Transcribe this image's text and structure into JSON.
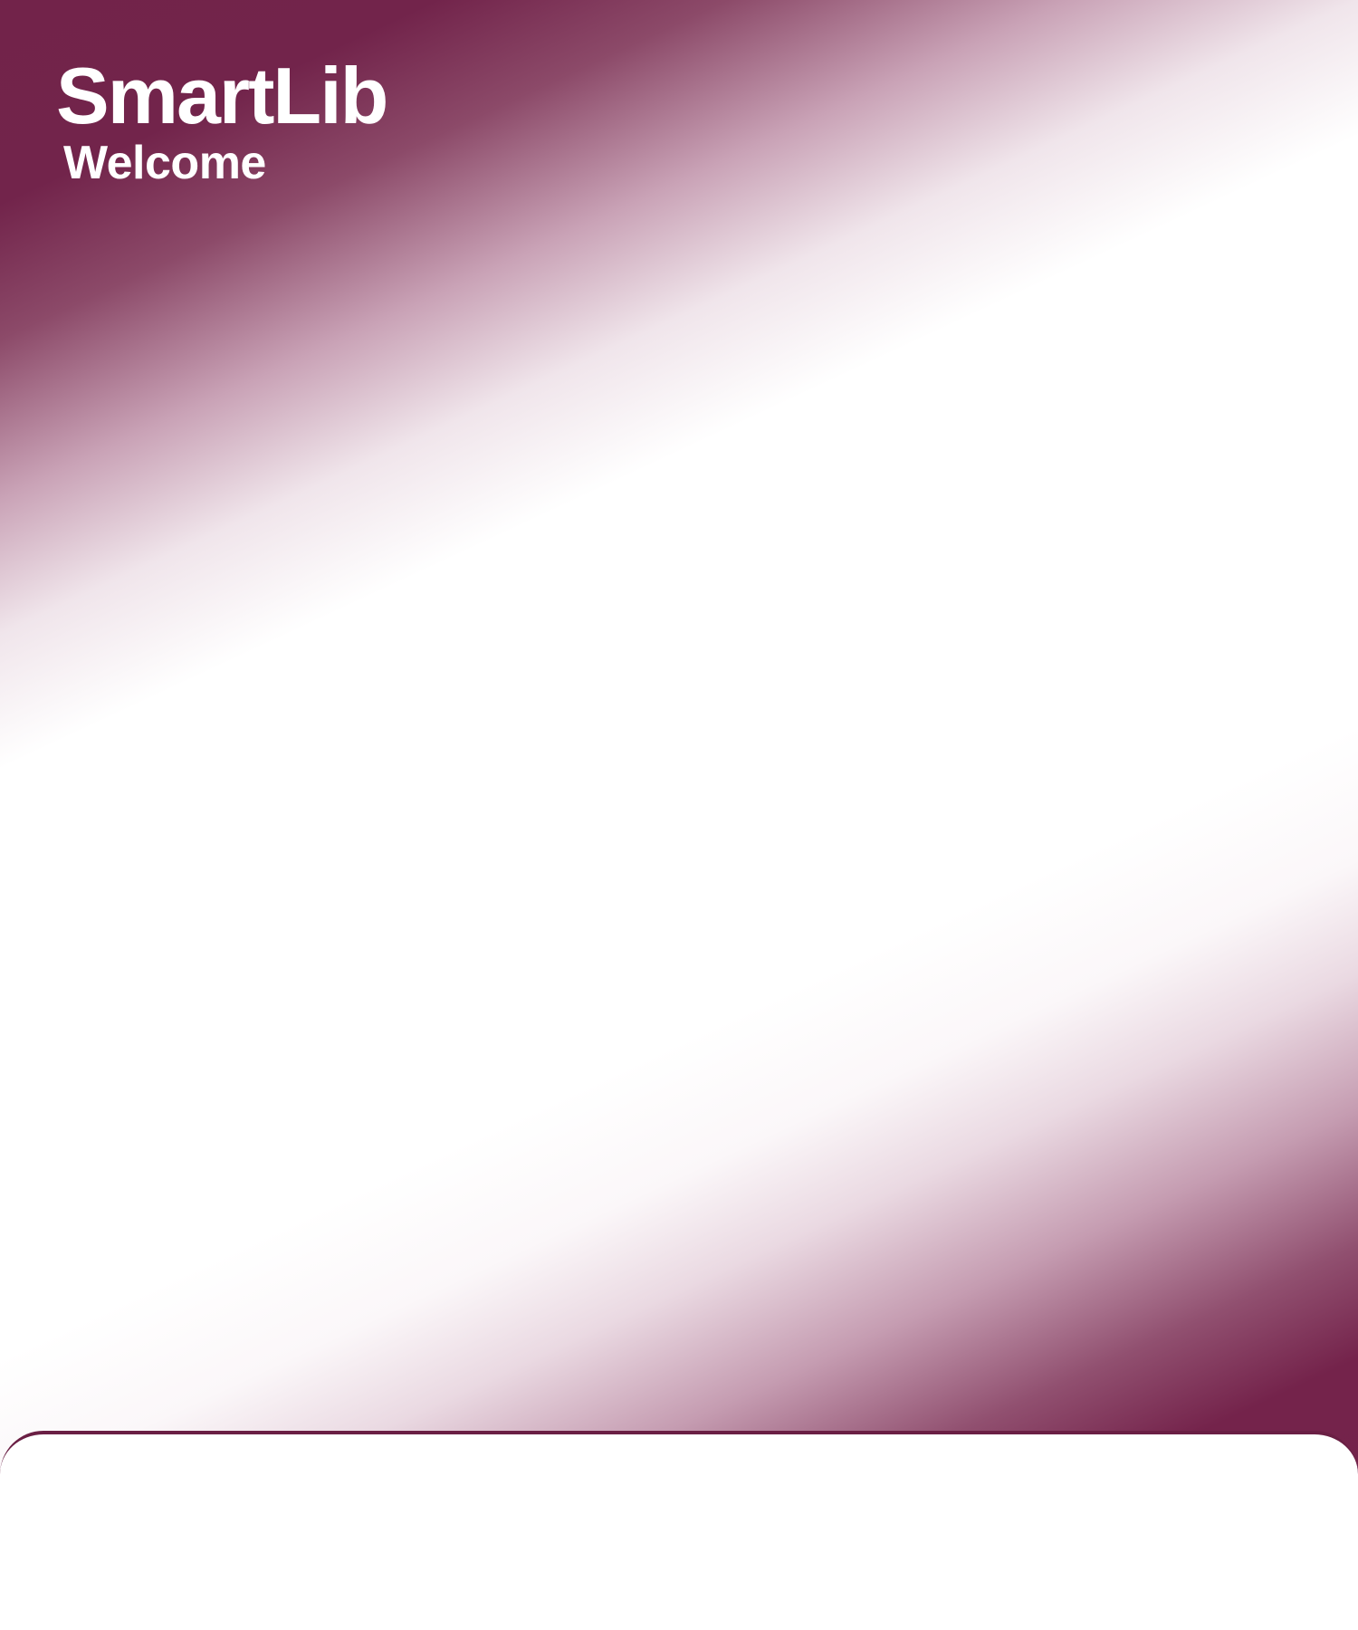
{
  "brand": {
    "logo_text": "SmartLib",
    "welcome_text": "Welcome"
  },
  "colors": {
    "brand_primary": "#72234a",
    "background": "#ffffff",
    "text_on_brand": "#ffffff"
  }
}
